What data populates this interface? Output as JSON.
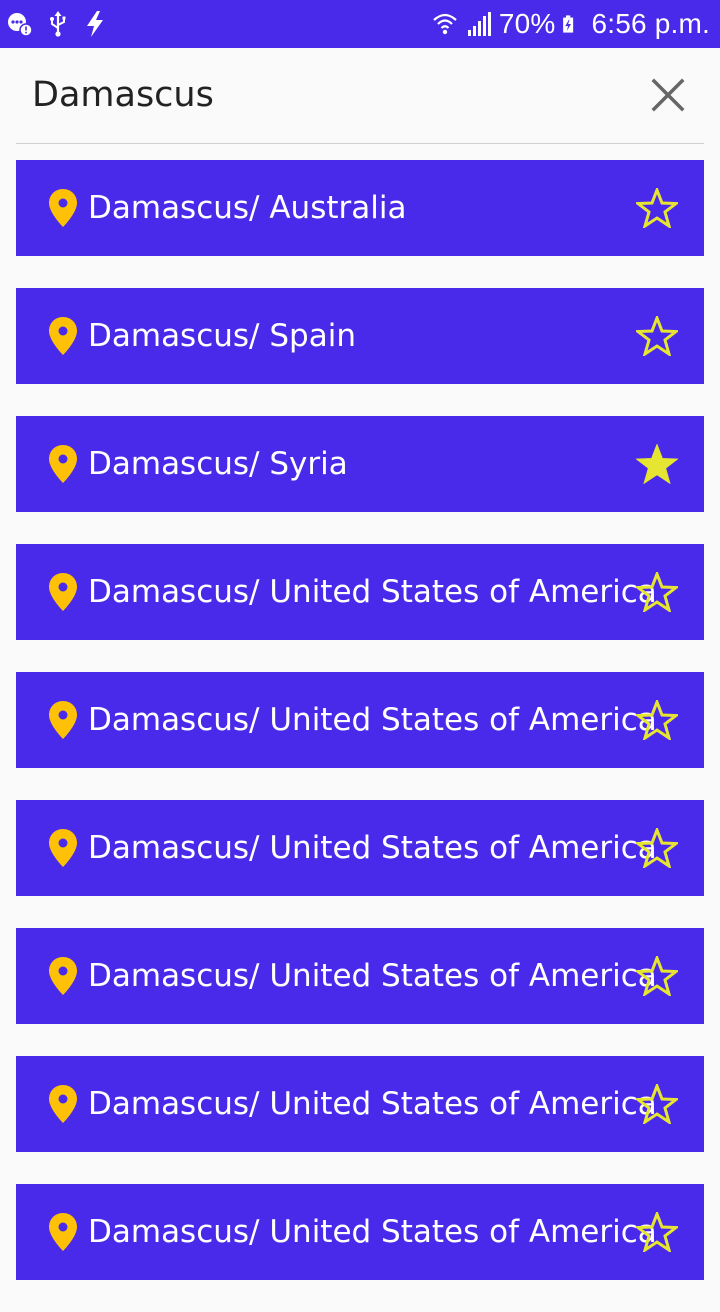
{
  "status_bar": {
    "battery": "70%",
    "time": "6:56 p.m.",
    "icons": [
      "notification-icon",
      "usb-icon",
      "charging-bolt-icon",
      "wifi-icon",
      "signal-icon",
      "battery-charging-icon"
    ]
  },
  "search": {
    "query": "Damascus",
    "close_icon": "close-icon"
  },
  "colors": {
    "accent": "#4a2aea",
    "pin": "#ffc107",
    "star": "#e6e632",
    "text_on_accent": "#ffffff"
  },
  "results": [
    {
      "label": "Damascus/ Australia",
      "favorite": false
    },
    {
      "label": "Damascus/ Spain",
      "favorite": false
    },
    {
      "label": "Damascus/ Syria",
      "favorite": true
    },
    {
      "label": "Damascus/ United States of America",
      "favorite": false
    },
    {
      "label": "Damascus/ United States of America",
      "favorite": false
    },
    {
      "label": "Damascus/ United States of America",
      "favorite": false
    },
    {
      "label": "Damascus/ United States of America",
      "favorite": false
    },
    {
      "label": "Damascus/ United States of America",
      "favorite": false
    },
    {
      "label": "Damascus/ United States of America",
      "favorite": false
    }
  ]
}
